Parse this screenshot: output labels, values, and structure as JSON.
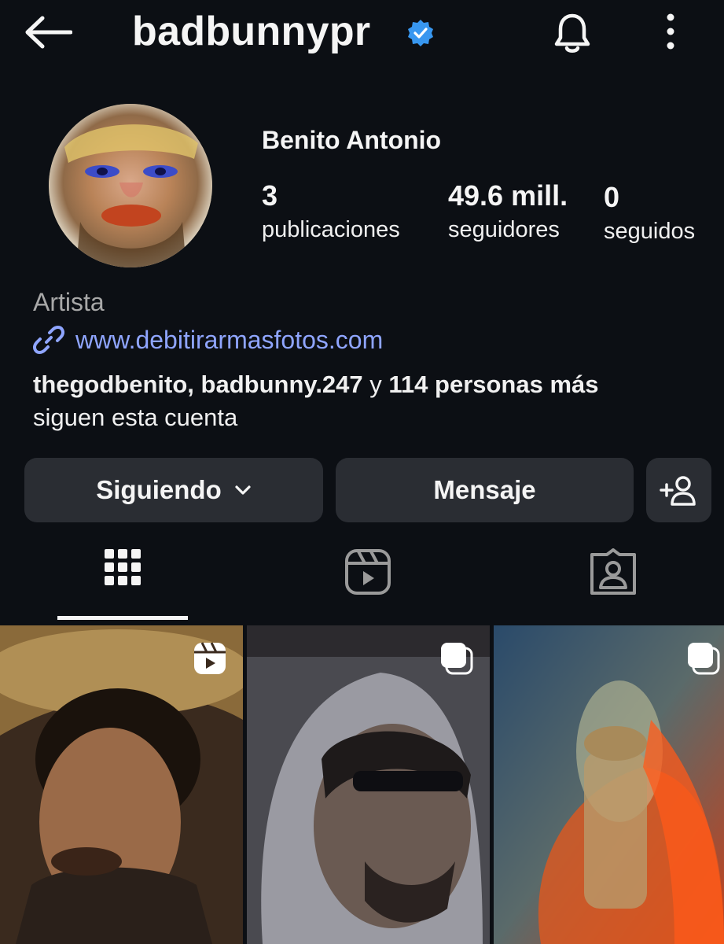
{
  "header": {
    "username": "badbunnypr",
    "back_icon": "arrow-left-icon",
    "verified_icon": "verified-badge-icon",
    "bell_icon": "bell-icon",
    "more_icon": "more-vertical-icon"
  },
  "profile": {
    "full_name": "Benito Antonio",
    "stats": [
      {
        "value": "3",
        "label": "publicaciones"
      },
      {
        "value": "49.6 mill.",
        "label": "seguidores"
      },
      {
        "value": "0",
        "label": "seguidos"
      }
    ],
    "category": "Artista",
    "link": "www.debitirarmasfotos.com",
    "followed_by": {
      "names": "thegodbenito, badbunny.247",
      "connector": " y ",
      "others": "114 personas más",
      "suffix": "siguen esta cuenta"
    }
  },
  "actions": {
    "following_label": "Siguiendo",
    "message_label": "Mensaje"
  },
  "tabs": [
    {
      "icon": "grid-icon",
      "active": true
    },
    {
      "icon": "reels-icon",
      "active": false
    },
    {
      "icon": "tagged-icon",
      "active": false
    }
  ],
  "colors": {
    "background": "#0c0f14",
    "button": "#2a2d33",
    "link": "#8fa5ff",
    "verified": "#3897f0",
    "muted": "#a8a8a8"
  }
}
